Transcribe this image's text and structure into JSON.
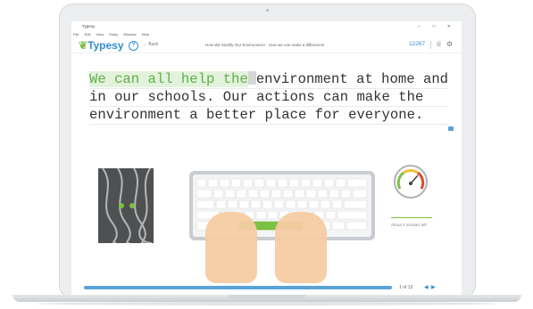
{
  "window": {
    "title": "Typesy",
    "controls": "–  □  ✕"
  },
  "menu": [
    "File",
    "Edit",
    "View",
    "Emily",
    "Window",
    "Help"
  ],
  "header": {
    "logo_text": "Typesy",
    "help_label": "?",
    "back_label": "← Back",
    "lesson_title": "How We Modify Our Environment - How we can make a difference!",
    "score": "12267"
  },
  "typing": {
    "line1_done": "We can all help the",
    "line1_rest": "environment at home and",
    "line2": "in our schools. Our actions can make the",
    "line3": "environment a better place for everyone."
  },
  "speed": {
    "label": "About 2 minutes left"
  },
  "footer": {
    "pager": "1 of 13"
  },
  "colors": {
    "accent": "#2f8fd1",
    "leaf": "#7cc142",
    "typed_bg": "#e3f2dc",
    "typed_text": "#5fb04a",
    "progress": "#5aa3d8"
  },
  "icons": [
    "help-circle-icon",
    "back-arrow-icon",
    "trophy-icon",
    "settings-gear-icon",
    "chat-icon",
    "prev-arrow-icon",
    "next-arrow-icon"
  ]
}
